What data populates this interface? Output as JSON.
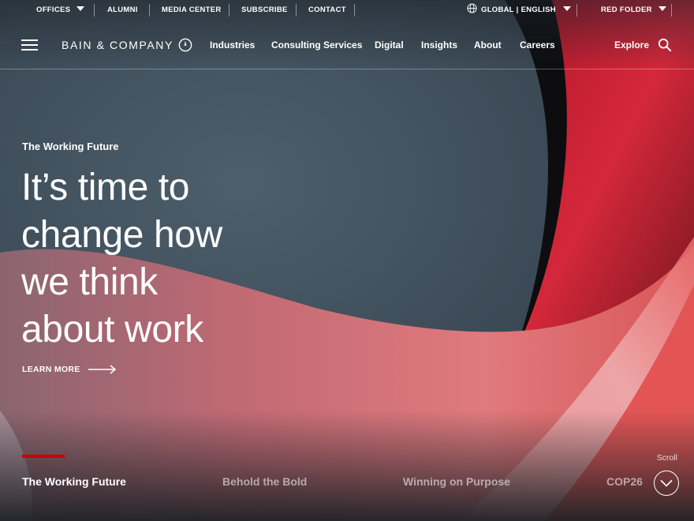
{
  "utility": {
    "offices": "OFFICES",
    "alumni": "ALUMNI",
    "media_center": "MEDIA CENTER",
    "subscribe": "SUBSCRIBE",
    "contact": "CONTACT",
    "locale": "GLOBAL | ENGLISH",
    "red_folder": "RED FOLDER"
  },
  "brand": {
    "name": "BAIN & COMPANY",
    "accent": "#cc0000"
  },
  "nav": {
    "items": [
      {
        "label": "Industries"
      },
      {
        "label": "Consulting Services"
      },
      {
        "label": "Digital"
      },
      {
        "label": "Insights"
      },
      {
        "label": "About"
      },
      {
        "label": "Careers"
      }
    ],
    "explore": "Explore"
  },
  "hero": {
    "eyebrow": "The Working Future",
    "headline_lines": [
      "It’s time to",
      "change how",
      "we think",
      "about work"
    ],
    "cta": "LEARN MORE"
  },
  "tabs": {
    "items": [
      {
        "label": "The Working Future",
        "active": true
      },
      {
        "label": "Behold the Bold",
        "active": false
      },
      {
        "label": "Winning on Purpose",
        "active": false
      },
      {
        "label": "COP26",
        "active": false
      }
    ],
    "scroll_label": "Scroll"
  },
  "icons": {
    "menu": "hamburger-icon",
    "globe": "globe-icon",
    "search": "search-icon",
    "arrow": "arrow-right-icon",
    "chevron": "chevron-down-icon"
  }
}
